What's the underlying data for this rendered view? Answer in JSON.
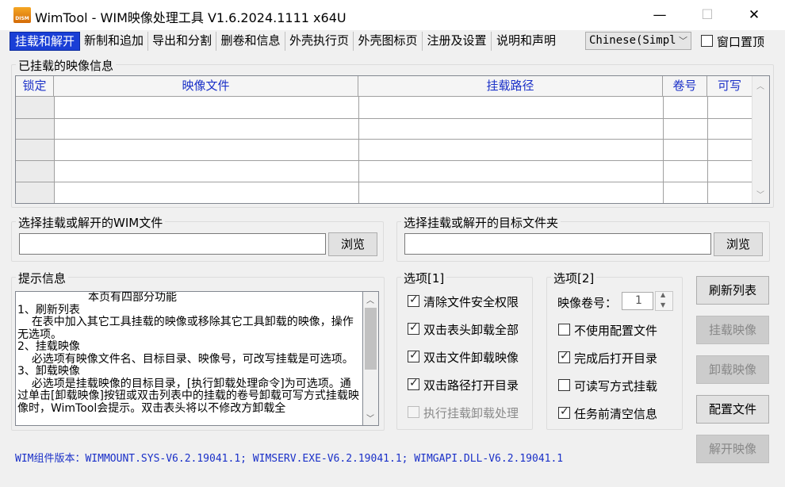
{
  "window": {
    "title": "WimTool - WIM映像处理工具 V1.6.2024.1111 x64U",
    "icon_text": "DISM",
    "minimize": "—",
    "maximize": "☐",
    "close": "✕"
  },
  "tabs": [
    "挂载和解开",
    "新制和追加",
    "导出和分割",
    "删卷和信息",
    "外壳执行页",
    "外壳图标页",
    "注册及设置",
    "说明和声明"
  ],
  "language": "Chinese(Simpl",
  "topmost_label": "窗口置顶",
  "mounted": {
    "group_title": "已挂载的映像信息",
    "columns": [
      "锁定",
      "映像文件",
      "挂载路径",
      "卷号",
      "可写"
    ]
  },
  "wim_file": {
    "group_title": "选择挂载或解开的WIM文件",
    "value": "",
    "browse": "浏览"
  },
  "target_folder": {
    "group_title": "选择挂载或解开的目标文件夹",
    "value": "",
    "browse": "浏览"
  },
  "hint": {
    "group_title": "提示信息",
    "text": "                    本页有四部分功能\n1、刷新列表\n    在表中加入其它工具挂载的映像或移除其它工具卸载的映像，操作无选项。\n2、挂载映像\n    必选项有映像文件名、目标目录、映像号，可改写挂载是可选项。\n3、卸载映像\n    必选项是挂载映像的目标目录，[执行卸载处理命令]为可选项。通过单击[卸载映像]按钮或双击列表中的挂载的卷号卸载可写方式挂载映像时，WimTool会提示。双击表头将以不修改方卸载全"
  },
  "options1": {
    "group_title": "选项[1]",
    "items": [
      {
        "label": "清除文件安全权限",
        "checked": true
      },
      {
        "label": "双击表头卸载全部",
        "checked": true
      },
      {
        "label": "双击文件卸载映像",
        "checked": true
      },
      {
        "label": "双击路径打开目录",
        "checked": true
      },
      {
        "label": "执行挂载卸载处理",
        "checked": false,
        "disabled": true
      }
    ]
  },
  "options2": {
    "group_title": "选项[2]",
    "volume_label": "映像卷号：",
    "volume_value": "1",
    "items": [
      {
        "label": "不使用配置文件",
        "checked": false
      },
      {
        "label": "完成后打开目录",
        "checked": true
      },
      {
        "label": "可读写方式挂载",
        "checked": false
      },
      {
        "label": "任务前清空信息",
        "checked": true
      }
    ]
  },
  "actions": [
    "刷新列表",
    "挂载映像",
    "卸载映像",
    "配置文件",
    "解开映像"
  ],
  "actions_disabled": [
    false,
    true,
    true,
    false,
    true
  ],
  "footer": "WIM组件版本：WIMMOUNT.SYS-V6.2.19041.1; WIMSERV.EXE-V6.2.19041.1; WIMGAPI.DLL-V6.2.19041.1",
  "colors": {
    "accent": "#1a3fd6",
    "header_text": "#1a30c8",
    "footer_text": "#1a30c8"
  }
}
